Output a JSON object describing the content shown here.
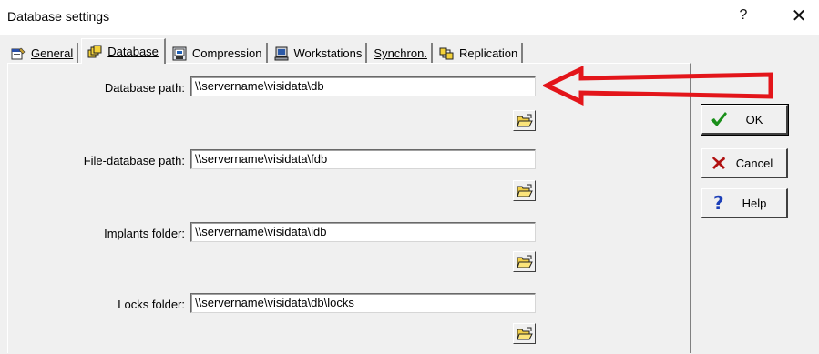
{
  "window": {
    "title": "Database settings",
    "help_glyph": "?",
    "close_glyph": "✕"
  },
  "tabs": [
    {
      "label": "General",
      "icon": "properties-icon"
    },
    {
      "label": "Database",
      "icon": "database-icon"
    },
    {
      "label": "Compression",
      "icon": "compression-icon"
    },
    {
      "label": "Workstations",
      "icon": "workstation-icon"
    },
    {
      "label": "Synchron.",
      "icon": ""
    },
    {
      "label": "Replication",
      "icon": "replication-icon"
    }
  ],
  "fields": [
    {
      "label": "Database path:",
      "value": "\\\\servername\\visidata\\db"
    },
    {
      "label": "File-database path:",
      "value": "\\\\servername\\visidata\\fdb"
    },
    {
      "label": "Implants folder:",
      "value": "\\\\servername\\visidata\\idb"
    },
    {
      "label": "Locks folder:",
      "value": "\\\\servername\\visidata\\db\\locks"
    }
  ],
  "buttons": {
    "ok": "OK",
    "cancel": "Cancel",
    "help": "Help"
  },
  "colors": {
    "annotation_arrow": "#e3151a",
    "ok_check": "#1a8f1a",
    "cancel_x": "#b01010",
    "help_q": "#1c3fb8"
  }
}
